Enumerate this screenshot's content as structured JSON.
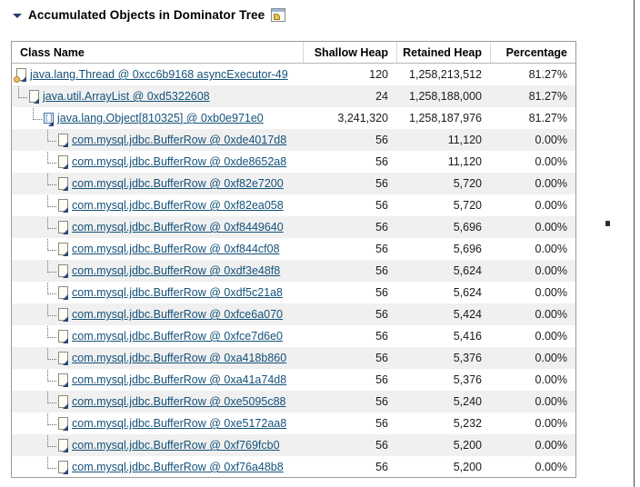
{
  "section": {
    "title": "Accumulated Objects in Dominator Tree",
    "twisty_icon": "chevron-down-icon",
    "panel_icon": "window-panel-icon",
    "expanded": true
  },
  "table": {
    "columns": [
      {
        "key": "class_name",
        "label": "Class Name",
        "align": "left"
      },
      {
        "key": "shallow_heap",
        "label": "Shallow Heap",
        "align": "right"
      },
      {
        "key": "retained_heap",
        "label": "Retained Heap",
        "align": "right"
      },
      {
        "key": "percentage",
        "label": "Percentage",
        "align": "right"
      }
    ],
    "rows": [
      {
        "class_name": "java.lang.Thread @ 0xcc6b9168 asyncExecutor-49",
        "shallow_heap": "120",
        "retained_heap": "1,258,213,512",
        "percentage": "81.27%",
        "depth": 0,
        "icon": "thread-icon"
      },
      {
        "class_name": "java.util.ArrayList @ 0xd5322608",
        "shallow_heap": "24",
        "retained_heap": "1,258,188,000",
        "percentage": "81.27%",
        "depth": 1,
        "icon": "object-icon"
      },
      {
        "class_name": "java.lang.Object[810325] @ 0xb0e971e0",
        "shallow_heap": "3,241,320",
        "retained_heap": "1,258,187,976",
        "percentage": "81.27%",
        "depth": 2,
        "icon": "array-icon"
      },
      {
        "class_name": "com.mysql.jdbc.BufferRow @ 0xde4017d8",
        "shallow_heap": "56",
        "retained_heap": "11,120",
        "percentage": "0.00%",
        "depth": 3,
        "icon": "object-icon"
      },
      {
        "class_name": "com.mysql.jdbc.BufferRow @ 0xde8652a8",
        "shallow_heap": "56",
        "retained_heap": "11,120",
        "percentage": "0.00%",
        "depth": 3,
        "icon": "object-icon"
      },
      {
        "class_name": "com.mysql.jdbc.BufferRow @ 0xf82e7200",
        "shallow_heap": "56",
        "retained_heap": "5,720",
        "percentage": "0.00%",
        "depth": 3,
        "icon": "object-icon"
      },
      {
        "class_name": "com.mysql.jdbc.BufferRow @ 0xf82ea058",
        "shallow_heap": "56",
        "retained_heap": "5,720",
        "percentage": "0.00%",
        "depth": 3,
        "icon": "object-icon"
      },
      {
        "class_name": "com.mysql.jdbc.BufferRow @ 0xf8449640",
        "shallow_heap": "56",
        "retained_heap": "5,696",
        "percentage": "0.00%",
        "depth": 3,
        "icon": "object-icon"
      },
      {
        "class_name": "com.mysql.jdbc.BufferRow @ 0xf844cf08",
        "shallow_heap": "56",
        "retained_heap": "5,696",
        "percentage": "0.00%",
        "depth": 3,
        "icon": "object-icon"
      },
      {
        "class_name": "com.mysql.jdbc.BufferRow @ 0xdf3e48f8",
        "shallow_heap": "56",
        "retained_heap": "5,624",
        "percentage": "0.00%",
        "depth": 3,
        "icon": "object-icon"
      },
      {
        "class_name": "com.mysql.jdbc.BufferRow @ 0xdf5c21a8",
        "shallow_heap": "56",
        "retained_heap": "5,624",
        "percentage": "0.00%",
        "depth": 3,
        "icon": "object-icon"
      },
      {
        "class_name": "com.mysql.jdbc.BufferRow @ 0xfce6a070",
        "shallow_heap": "56",
        "retained_heap": "5,424",
        "percentage": "0.00%",
        "depth": 3,
        "icon": "object-icon"
      },
      {
        "class_name": "com.mysql.jdbc.BufferRow @ 0xfce7d6e0",
        "shallow_heap": "56",
        "retained_heap": "5,416",
        "percentage": "0.00%",
        "depth": 3,
        "icon": "object-icon"
      },
      {
        "class_name": "com.mysql.jdbc.BufferRow @ 0xa418b860",
        "shallow_heap": "56",
        "retained_heap": "5,376",
        "percentage": "0.00%",
        "depth": 3,
        "icon": "object-icon"
      },
      {
        "class_name": "com.mysql.jdbc.BufferRow @ 0xa41a74d8",
        "shallow_heap": "56",
        "retained_heap": "5,376",
        "percentage": "0.00%",
        "depth": 3,
        "icon": "object-icon"
      },
      {
        "class_name": "com.mysql.jdbc.BufferRow @ 0xe5095c88",
        "shallow_heap": "56",
        "retained_heap": "5,240",
        "percentage": "0.00%",
        "depth": 3,
        "icon": "object-icon"
      },
      {
        "class_name": "com.mysql.jdbc.BufferRow @ 0xe5172aa8",
        "shallow_heap": "56",
        "retained_heap": "5,232",
        "percentage": "0.00%",
        "depth": 3,
        "icon": "object-icon"
      },
      {
        "class_name": "com.mysql.jdbc.BufferRow @ 0xf769fcb0",
        "shallow_heap": "56",
        "retained_heap": "5,200",
        "percentage": "0.00%",
        "depth": 3,
        "icon": "object-icon"
      },
      {
        "class_name": "com.mysql.jdbc.BufferRow @ 0xf76a48b8",
        "shallow_heap": "56",
        "retained_heap": "5,200",
        "percentage": "0.00%",
        "depth": 3,
        "icon": "object-icon"
      }
    ]
  },
  "colors": {
    "link": "#14527a",
    "row_alt": "#f0f0f0",
    "border": "#9b9b9b",
    "text": "#1a1a1a"
  }
}
